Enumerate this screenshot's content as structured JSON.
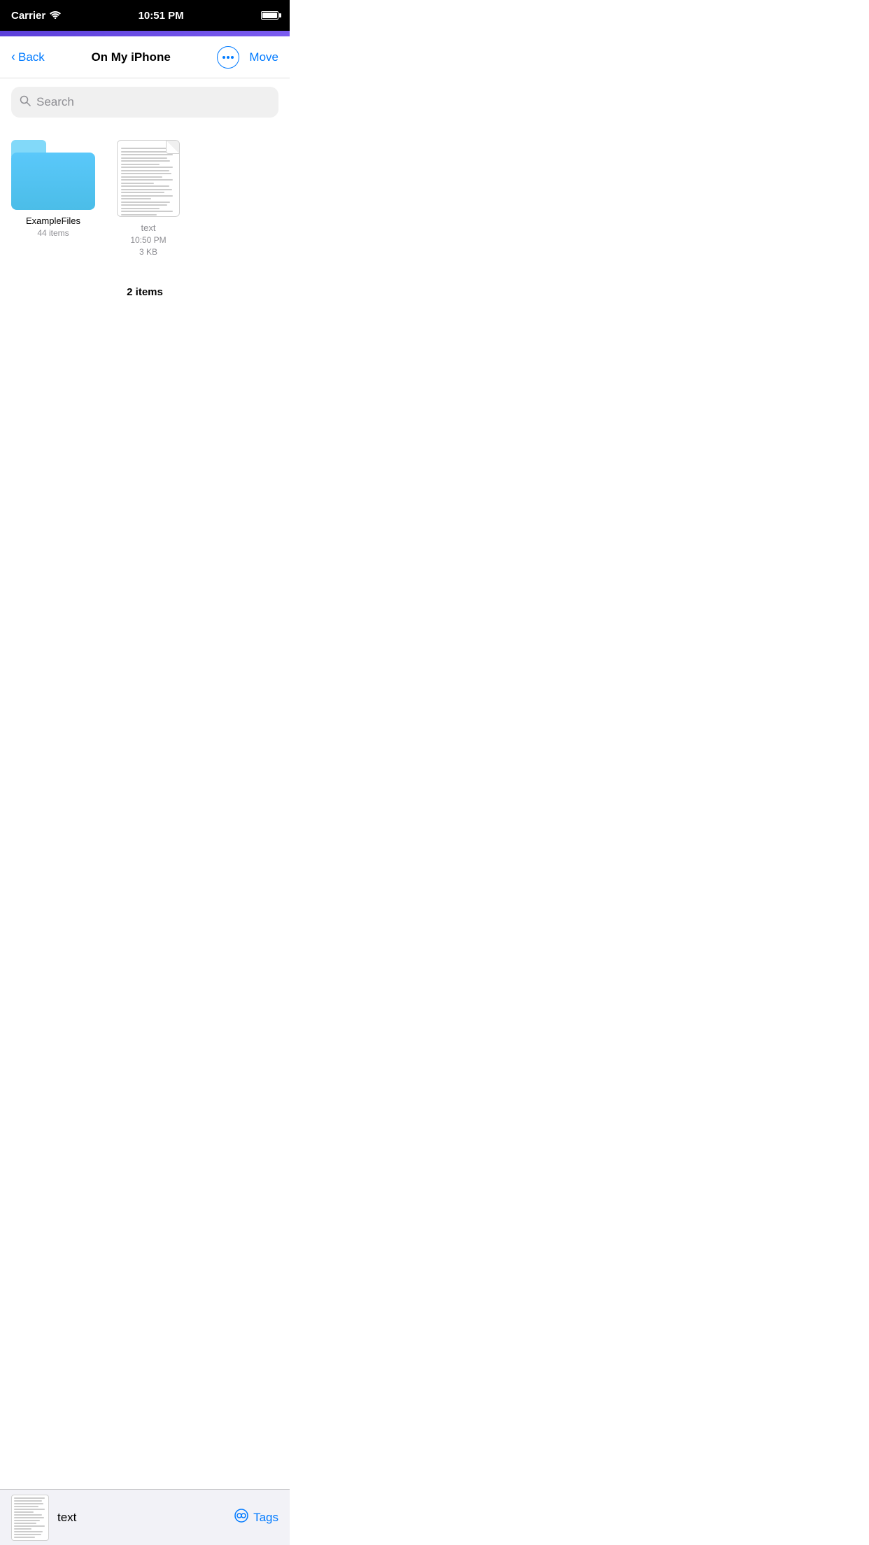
{
  "statusBar": {
    "carrier": "Carrier",
    "time": "10:51 PM",
    "wifi": true,
    "battery": 100
  },
  "navBar": {
    "backLabel": "Back",
    "title": "On My iPhone",
    "moreLabel": "⋯",
    "moveLabel": "Move"
  },
  "search": {
    "placeholder": "Search"
  },
  "files": [
    {
      "type": "folder",
      "name": "ExampleFiles",
      "meta": "44 items"
    },
    {
      "type": "document",
      "name": "text",
      "meta_line1": "10:50 PM",
      "meta_line2": "3 KB"
    }
  ],
  "footer": {
    "itemCount": "2 items"
  },
  "bottomBar": {
    "filename": "text",
    "tagsLabel": "Tags"
  }
}
